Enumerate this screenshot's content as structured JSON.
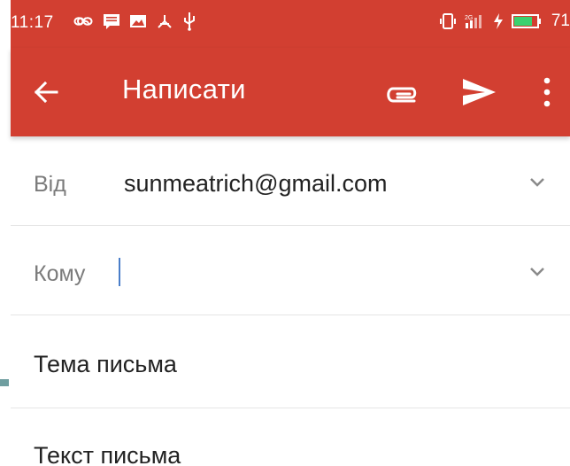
{
  "status_bar": {
    "time": "11:17",
    "battery_level": "71",
    "icons_left": [
      "infinity-icon",
      "message-icon",
      "image-icon",
      "pdf-icon",
      "usb-icon"
    ],
    "icons_right": [
      "vibrate-icon",
      "signal-icon",
      "charging-icon",
      "battery-icon"
    ]
  },
  "app_bar": {
    "title": "Написати",
    "icons": [
      "back-arrow-icon",
      "paperclip-icon",
      "send-icon",
      "more-vert-icon"
    ]
  },
  "compose": {
    "from_label": "Від",
    "from_value": "sunmeatrich@gmail.com",
    "to_label": "Кому",
    "to_value": "",
    "subject_placeholder": "Тема письма",
    "body_placeholder": "Текст письма"
  },
  "colors": {
    "primary": "#d23f31",
    "caret": "#4a7ec9",
    "battery": "#3bd16f"
  }
}
